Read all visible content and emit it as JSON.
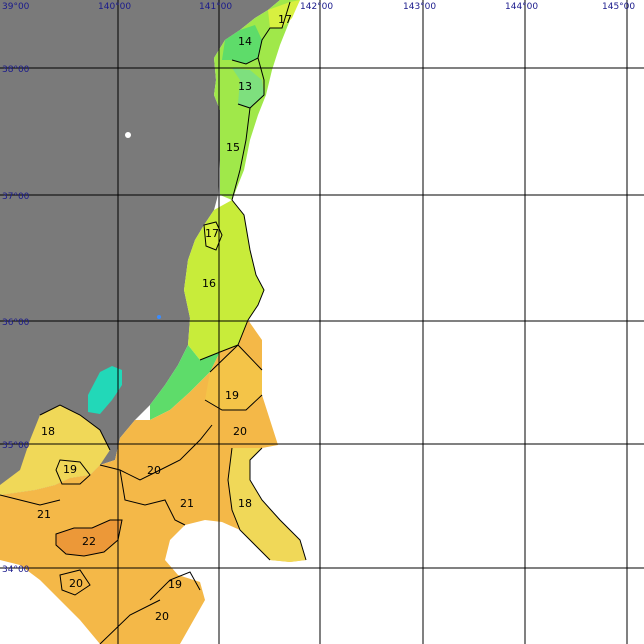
{
  "grid": {
    "longitudes": [
      "139°00",
      "140°00",
      "141°00",
      "142°00",
      "143°00",
      "144°00",
      "145°00"
    ],
    "latitudes": [
      "38°00",
      "37°00",
      "36°00",
      "35°00",
      "34°00"
    ],
    "top_left_lat": "39°00",
    "axis_label_color": "#1a1a8c",
    "grid_line_color": "#000000"
  },
  "map": {
    "land_color": "#7a7a7a",
    "sea_color": "#ffffff"
  },
  "color_scale": {
    "13": "#7ee07e",
    "14": "#5edc6a",
    "15": "#a0e84a",
    "16": "#c8ec3a",
    "17": "#d8f040",
    "18": "#f0d858",
    "19": "#f4c448",
    "20": "#f4b848",
    "21": "#f0a840",
    "22": "#ec9838",
    "cold": "#22d8b8"
  },
  "contour_labels": [
    "17",
    "14",
    "13",
    "15",
    "17",
    "16",
    "19",
    "20",
    "18",
    "19",
    "20",
    "21",
    "18",
    "21",
    "22",
    "20",
    "19",
    "20"
  ]
}
